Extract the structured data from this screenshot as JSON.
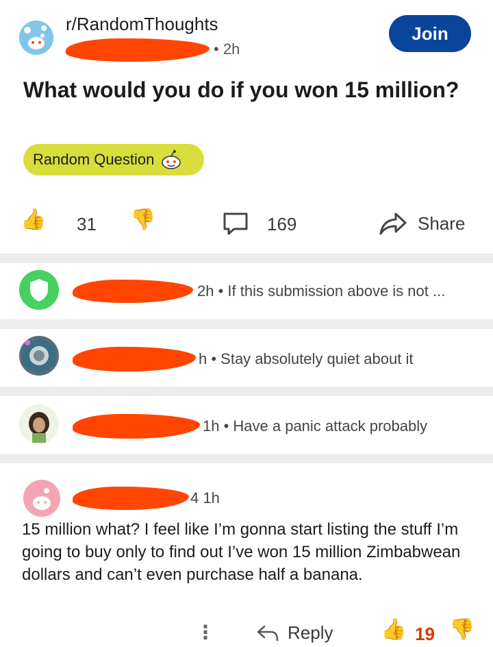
{
  "post": {
    "subreddit": "r/RandomThoughts",
    "time": "2h",
    "join_label": "Join",
    "title": "What would you do if you won 15 million?",
    "flair": "Random Question",
    "upvotes": "31",
    "comments": "169",
    "share_label": "Share"
  },
  "comments": [
    {
      "meta": "2h • If this submission above is not ..."
    },
    {
      "meta": "h • Stay absolutely quiet about it"
    },
    {
      "meta": "1h • Have a panic attack probably"
    }
  ],
  "expanded_comment": {
    "meta": "4  1h",
    "body": "15 million what? I feel like I’m gonna start listing the stuff I’m going to buy only to find out I’ve won 15 million Zimbabwean dollars and can’t even purchase half a banana.",
    "more_label": "⋮",
    "reply_label": "Reply",
    "upvotes": "19"
  },
  "colors": {
    "join": "#0a449b",
    "flair": "#d7dd3a",
    "redaction": "#ff4500",
    "mod_shield": "#46d160"
  },
  "icons": [
    "subreddit-avatar-icon",
    "thumbs-up-icon",
    "thumbs-down-icon",
    "comment-bubble-icon",
    "share-arrow-icon",
    "mod-shield-icon",
    "reply-arrow-icon",
    "more-vertical-icon"
  ]
}
